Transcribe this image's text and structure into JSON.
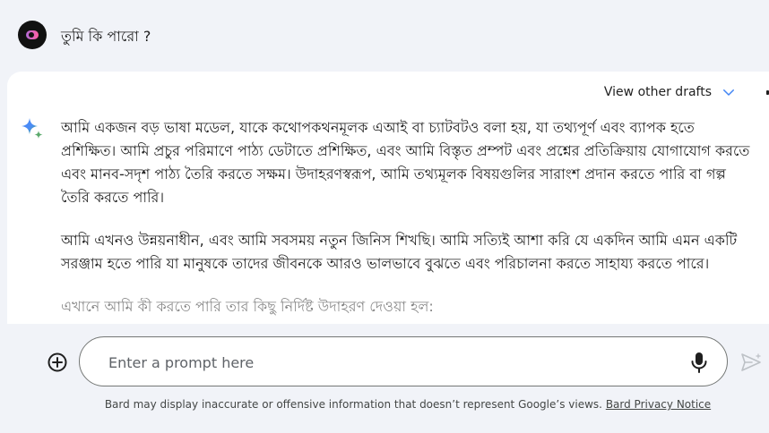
{
  "user": {
    "prompt": "তুমি কি পারো ?"
  },
  "response": {
    "view_drafts_label": "View other drafts",
    "paragraphs": [
      "আমি একজন বড় ভাষা মডেল, যাকে কথোপকথনমূলক এআই বা চ্যাটবটও বলা হয়, যা তথ্যপূর্ণ এবং ব্যাপক হতে প্রশিক্ষিত। আমি প্রচুর পরিমাণে পাঠ্য ডেটাতে প্রশিক্ষিত, এবং আমি বিস্তৃত প্রম্পট এবং প্রশ্নের প্রতিক্রিয়ায় যোগাযোগ করতে এবং মানব-সদৃশ পাঠ্য তৈরি করতে সক্ষম। উদাহরণস্বরূপ, আমি তথ্যমূলক বিষয়গুলির সারাংশ প্রদান করতে পারি বা গল্প তৈরি করতে পারি।",
      "আমি এখনও উন্নয়নাধীন, এবং আমি সবসময় নতুন জিনিস শিখছি। আমি সত্যিই আশা করি যে একদিন আমি এমন একটি সরঞ্জাম হতে পারি যা মানুষকে তাদের জীবনকে আরও ভালভাবে বুঝতে এবং পরিচালনা করতে সাহায্য করতে পারে।",
      "এখানে আমি কী করতে পারি তার কিছু নির্দিষ্ট উদাহরণ দেওয়া হল:"
    ]
  },
  "input": {
    "placeholder": "Enter a prompt here"
  },
  "footer": {
    "disclaimer": "Bard may display inaccurate or offensive information that doesn’t represent Google’s views.",
    "privacy_link": "Bard Privacy Notice"
  },
  "colors": {
    "background": "#f1f3f8",
    "card": "#ffffff",
    "accent": "#4285f4",
    "text": "#1f1f1f"
  },
  "icons": {
    "avatar": "user-avatar",
    "bard": "bard-sparkle-icon",
    "drafts": "chevron-down-icon",
    "add": "add-circle-icon",
    "mic": "microphone-icon",
    "send": "send-icon"
  }
}
